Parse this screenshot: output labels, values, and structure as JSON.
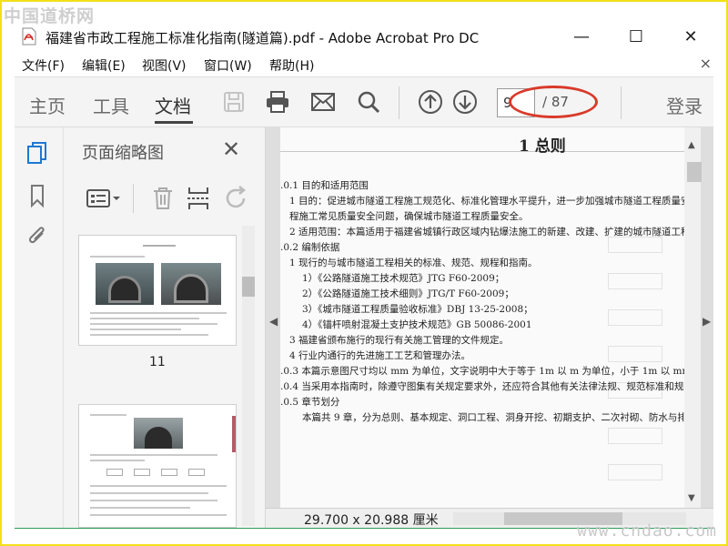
{
  "watermark": {
    "top": "中国道桥网",
    "bottom": "www.cndao.com"
  },
  "window": {
    "title": "福建省市政工程施工标准化指南(隧道篇).pdf - Adobe Acrobat Pro DC",
    "minimize_glyph": "—",
    "maximize_glyph": "☐",
    "close_glyph": "✕"
  },
  "menu": {
    "items": [
      "文件(F)",
      "编辑(E)",
      "视图(V)",
      "窗口(W)",
      "帮助(H)"
    ],
    "close_glyph": "×"
  },
  "toolbar": {
    "tabs": [
      "主页",
      "工具",
      "文档"
    ],
    "active_tab": "文档",
    "icons": [
      "save-icon",
      "print-icon",
      "email-icon",
      "search-icon",
      "page-up-icon",
      "page-down-icon"
    ],
    "page_current": "9",
    "page_total": "/ 87",
    "login": "登录",
    "annotation_color": "#d93a2a"
  },
  "left_rail": {
    "icons": [
      "pages-icon",
      "bookmark-icon",
      "attachment-icon"
    ]
  },
  "thumbnail_panel": {
    "title": "页面缩略图",
    "close_glyph": "✕",
    "tools": [
      "options-icon",
      "delete-icon",
      "insert-icon",
      "rotate-icon"
    ],
    "thumbnails": [
      {
        "label": "11"
      },
      {
        "label": ""
      }
    ]
  },
  "document": {
    "chapter_title": "1 总则",
    "lines": [
      ".0.1 目的和适用范围",
      "1 目的：促进城市隧道工程施工规范化、标准化管理水平提升，进一步加强城市隧道工程质量安",
      "程施工常见质量安全问题，确保城市隧道工程质量安全。",
      "2 适用范围：本篇适用于福建省城镇行政区域内钻爆法施工的新建、改建、扩建的城市隧道工程",
      ".0.2 编制依据",
      "1 现行的与城市隧道工程相关的标准、规范、规程和指南。",
      "1）《公路隧道施工技术规范》JTG F60-2009；",
      "2）《公路隧道施工技术细则》JTG/T F60-2009；",
      "3）《城市隧道工程质量验收标准》DBJ 13-25-2008；",
      "4）《锚杆喷射混凝土支护技术规范》GB 50086-2001",
      "3 福建省颁布施行的现行有关施工管理的文件规定。",
      "4 行业内通行的先进施工工艺和管理办法。",
      ".0.3 本篇示意图尺寸均以 mm 为单位，文字说明中大于等于 1m 以 m 为单位，小于 1m 以 mm 为单",
      ".0.4 当采用本指南时，除遵守图集有关规定要求外，还应符合其他有关法律法规、规范标准和规",
      ".0.5 章节划分",
      "本篇共 9 章，分为总则、基本规定、洞口工程、洞身开挖、初期支护、二次衬砌、防水与排水"
    ],
    "page_size": "29.700 x 20.988 厘米"
  }
}
